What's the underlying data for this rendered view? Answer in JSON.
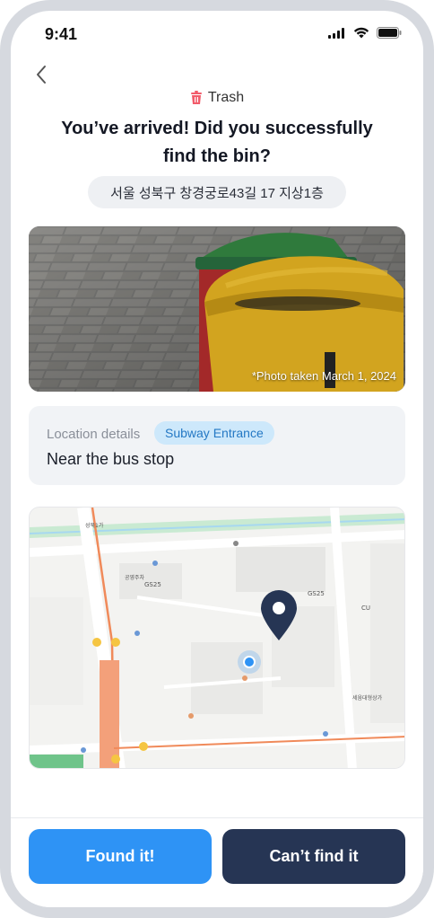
{
  "status_bar": {
    "time": "9:41"
  },
  "header": {
    "category_icon": "trash-icon",
    "category_label": "Trash",
    "title": "You’ve arrived! Did you successfully find the bin?",
    "address": "서울 성북구 창경궁로43길 17 지상1층"
  },
  "photo": {
    "caption": "*Photo taken March 1, 2024"
  },
  "location_details": {
    "label": "Location details",
    "badge": "Subway Entrance",
    "value": "Near the bus stop"
  },
  "map": {
    "labels": [
      "GS25",
      "CU",
      "성북1가",
      "공영주차",
      "세움대형상가"
    ],
    "pin_icon": "map-pin-icon",
    "current_location_icon": "current-location-dot-icon"
  },
  "actions": {
    "found_label": "Found it!",
    "cant_find_label": "Can’t find it"
  },
  "colors": {
    "primary": "#2e93f5",
    "secondary": "#263554",
    "badge_bg": "#cde8fb",
    "badge_text": "#2478c4"
  }
}
